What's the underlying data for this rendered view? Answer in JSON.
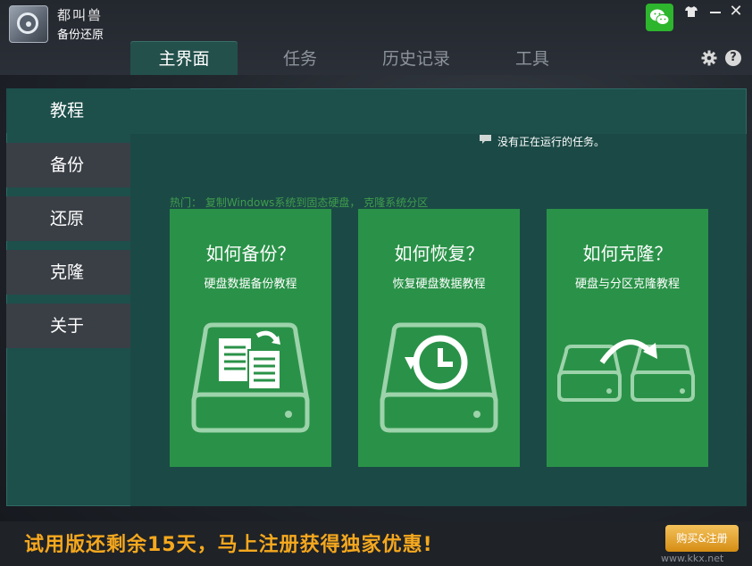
{
  "app": {
    "brand_name": "都叫兽",
    "subtitle": "备份还原"
  },
  "tabs": [
    {
      "label": "主界面",
      "active": true
    },
    {
      "label": "任务",
      "active": false
    },
    {
      "label": "历史记录",
      "active": false
    },
    {
      "label": "工具",
      "active": false
    }
  ],
  "window_controls": {
    "help": "?",
    "close": "✕"
  },
  "sidebar": [
    {
      "label": "教程",
      "active": true
    },
    {
      "label": "备份",
      "active": false
    },
    {
      "label": "还原",
      "active": false
    },
    {
      "label": "克隆",
      "active": false
    },
    {
      "label": "关于",
      "active": false
    }
  ],
  "status_text": "没有正在运行的任务。",
  "hot_text": "热门：  复制Windows系统到固态硬盘，  克隆系统分区",
  "cards": [
    {
      "title": "如何备份？",
      "subtitle": "硬盘数据备份教程",
      "icon": "backup-disk-icon"
    },
    {
      "title": "如何恢复？",
      "subtitle": "恢复硬盘数据教程",
      "icon": "restore-disk-icon"
    },
    {
      "title": "如何克隆？",
      "subtitle": "硬盘与分区克隆教程",
      "icon": "clone-disk-icon"
    }
  ],
  "footer": {
    "promo": "试用版还剩余15天，马上注册获得独家优惠!",
    "buy_label": "购买&注册",
    "watermark": "www.kkx.net"
  },
  "colors": {
    "accent_green": "#2a9248",
    "panel_teal": "#1d4f4b",
    "promo_orange": "#f5a81e",
    "buy_gold": "#e3a130"
  }
}
